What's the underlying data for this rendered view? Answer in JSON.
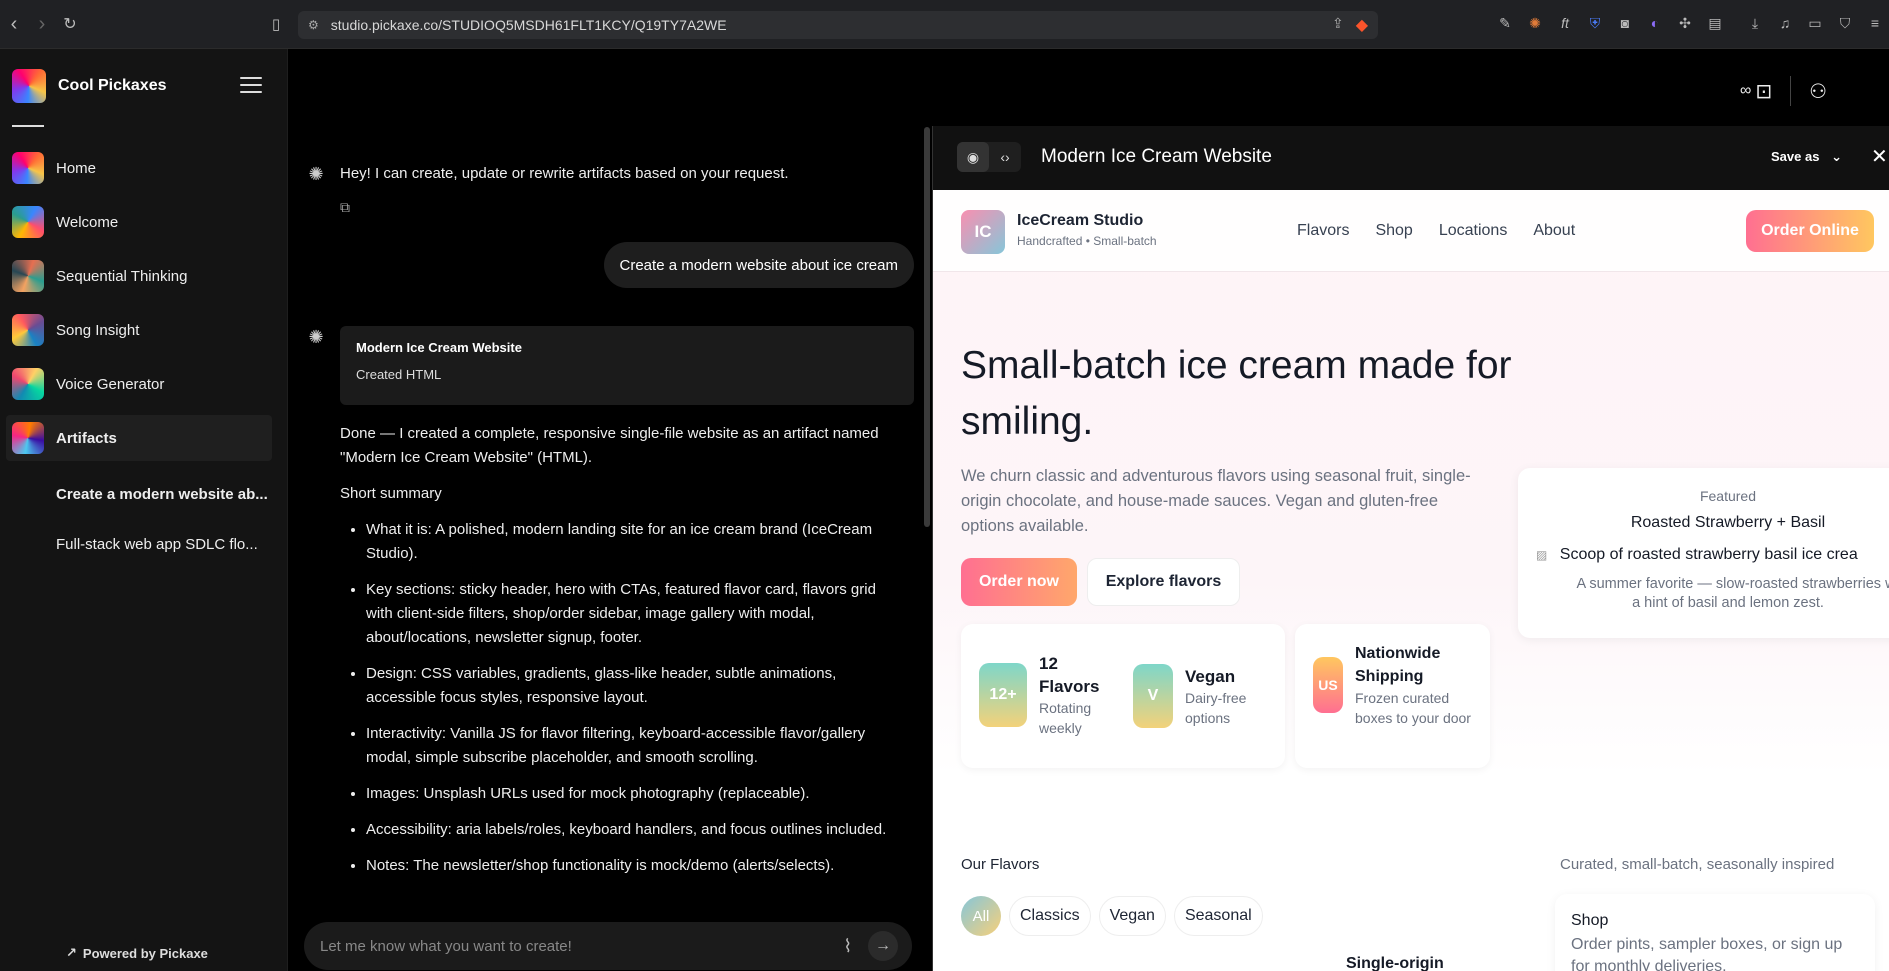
{
  "browser": {
    "url": "studio.pickaxe.co/STUDIOQ5MSDH61FLT1KCY/Q19TY7A2WE"
  },
  "sidebar": {
    "brand": "Cool Pickaxes",
    "items": [
      {
        "label": "Home"
      },
      {
        "label": "Welcome"
      },
      {
        "label": "Sequential Thinking"
      },
      {
        "label": "Song Insight"
      },
      {
        "label": "Voice Generator"
      },
      {
        "label": "Artifacts"
      }
    ],
    "sub_items": [
      {
        "label": "Create a modern website ab..."
      },
      {
        "label": "Full-stack web app SDLC flo..."
      }
    ],
    "powered": "Powered by Pickaxe"
  },
  "chat": {
    "bot_greeting": "Hey! I can create, update or rewrite artifacts based on your request.",
    "user_message": "Create a modern website about ice cream",
    "artifact_card": {
      "title": "Modern Ice Cream Website",
      "subtitle": "Created HTML"
    },
    "done_text": "Done — I created a complete, responsive single-file website as an artifact named \"Modern Ice Cream Website\" (HTML).",
    "summary_heading": "Short summary",
    "bullets": [
      "What it is: A polished, modern landing site for an ice cream brand (IceCream Studio).",
      "Key sections: sticky header, hero with CTAs, featured flavor card, flavors grid with client-side filters, shop/order sidebar, image gallery with modal, about/locations, newsletter signup, footer.",
      "Design: CSS variables, gradients, glass-like header, subtle animations, accessible focus styles, responsive layout.",
      "Interactivity: Vanilla JS for flavor filtering, keyboard-accessible flavor/gallery modal, simple subscribe placeholder, and smooth scrolling.",
      "Images: Unsplash URLs used for mock photography (replaceable).",
      "Accessibility: aria labels/roles, keyboard handlers, and focus outlines included.",
      "Notes: The newsletter/shop functionality is mock/demo (alerts/selects)."
    ],
    "input_placeholder": "Let me know what you want to create!"
  },
  "top_controls": {
    "infinity": "∞"
  },
  "panel": {
    "title": "Modern Ice Cream Website",
    "save_as": "Save as"
  },
  "site": {
    "logo": "IC",
    "name": "IceCream Studio",
    "tagline": "Handcrafted • Small-batch",
    "nav": [
      "Flavors",
      "Shop",
      "Locations",
      "About"
    ],
    "order_online": "Order Online",
    "hero_title": "Small-batch ice cream made for smiling.",
    "hero_sub": "We churn classic and adventurous flavors using seasonal fruit, single-origin chocolate, and house-made sauces. Vegan and gluten-free options available.",
    "btn_order": "Order now",
    "btn_explore": "Explore flavors",
    "stats": [
      {
        "badge": "12+",
        "title": "12 Flavors",
        "sub": "Rotating weekly"
      },
      {
        "badge": "V",
        "title": "Vegan",
        "sub": "Dairy-free options"
      },
      {
        "badge": "US",
        "title": "Nationwide Shipping",
        "sub": "Frozen curated boxes to your door"
      }
    ],
    "featured": {
      "label": "Featured",
      "name": "Roasted Strawberry + Basil",
      "img_alt": "Scoop of roasted strawberry basil ice crea",
      "desc1": "A summer favorite — slow-roasted strawberries w",
      "desc2": "a hint of basil and lemon zest."
    },
    "flavors_title": "Our Flavors",
    "flavors_sub": "Curated, small-batch, seasonally inspired",
    "filters": [
      "All",
      "Classics",
      "Vegan",
      "Seasonal"
    ],
    "shop": {
      "title": "Shop",
      "sub": "Order pints, sampler boxes, or sign up for monthly deliveries."
    },
    "single_origin": "Single-origin"
  }
}
